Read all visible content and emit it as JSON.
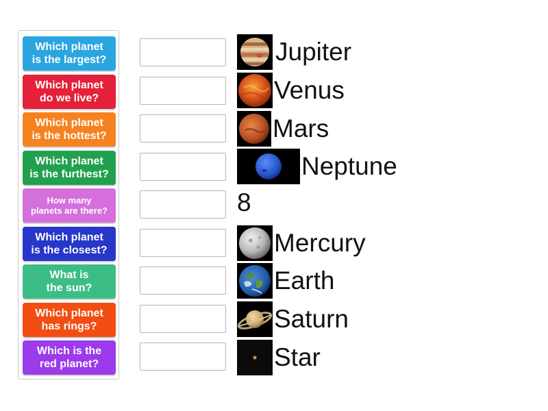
{
  "questions": [
    {
      "text": "Which planet\nis the largest?",
      "color": "#2aa5e0"
    },
    {
      "text": "Which planet\ndo we live?",
      "color": "#e5203a"
    },
    {
      "text": "Which planet\nis the hottest?",
      "color": "#f6821f"
    },
    {
      "text": "Which planet\nis the furthest?",
      "color": "#21a04e"
    },
    {
      "text": "How many\nplanets are there?",
      "color": "#d46fdc"
    },
    {
      "text": "Which planet\nis the closest?",
      "color": "#2637c9"
    },
    {
      "text": "What is\nthe sun?",
      "color": "#3dbd86"
    },
    {
      "text": "Which planet\nhas rings?",
      "color": "#f24d12"
    },
    {
      "text": "Which is the\nred planet?",
      "color": "#9b3bea"
    }
  ],
  "answers": [
    {
      "text": "Jupiter",
      "icon": "jupiter-icon"
    },
    {
      "text": "Venus",
      "icon": "venus-icon"
    },
    {
      "text": "Mars",
      "icon": "mars-icon"
    },
    {
      "text": "Neptune",
      "icon": "neptune-icon"
    },
    {
      "text": "8",
      "icon": ""
    },
    {
      "text": "Mercury",
      "icon": "mercury-icon"
    },
    {
      "text": "Earth",
      "icon": "earth-icon"
    },
    {
      "text": "Saturn",
      "icon": "saturn-icon"
    },
    {
      "text": "Star",
      "icon": "star-icon"
    }
  ]
}
